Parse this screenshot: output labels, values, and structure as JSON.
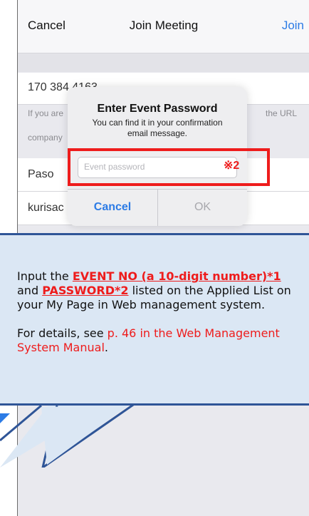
{
  "navbar": {
    "cancel_label": "Cancel",
    "title": "Join Meeting",
    "join_label": "Join"
  },
  "meeting": {
    "number": "170 384 4163"
  },
  "hints": {
    "line1_start": "If you are",
    "line1_end": "the URL",
    "line2_start": "company"
  },
  "form": {
    "name_partial": "Paso",
    "email_partial": "kurisac"
  },
  "dialog": {
    "title": "Enter Event Password",
    "message": "You can find it in your confirmation email message.",
    "input_placeholder": "Event password",
    "cancel_label": "Cancel",
    "ok_label": "OK"
  },
  "annotation": {
    "mark": "※2"
  },
  "callout": {
    "p1_before": "Input the ",
    "p1_event": "EVENT NO (a 10-digit number)*1",
    "p1_and": " and ",
    "p1_password": "PASSWORD*2",
    "p1_after": " listed on the Applied List on your My Page in Web management system.",
    "p2_before": "For details, see ",
    "p2_ref": "p. 46 in the Web Management System Manual",
    "p2_after": "."
  },
  "colors": {
    "accent_blue": "#2c7be5",
    "highlight_red": "#ee1c1c",
    "callout_bg": "#dbe7f4",
    "callout_border": "#2f5597"
  }
}
